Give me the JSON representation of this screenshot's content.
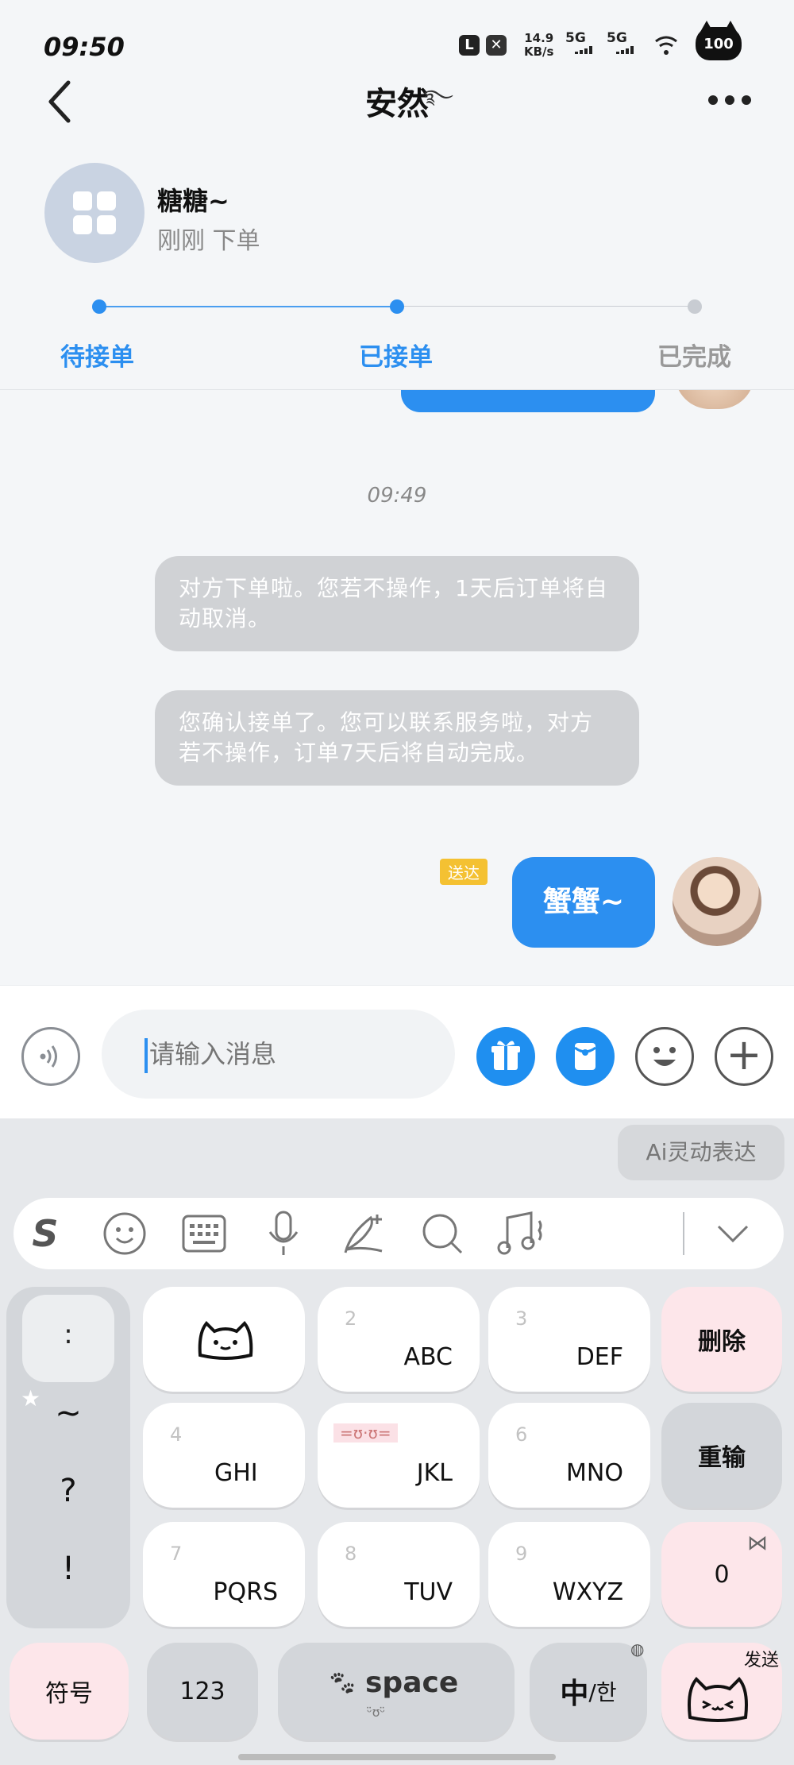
{
  "status_bar": {
    "time": "09:50",
    "net_speed": "14.9",
    "net_speed_unit": "KB/s",
    "signal1": "5G",
    "signal2": "5G",
    "battery": "100"
  },
  "header": {
    "title": "安然",
    "title_deco": "࿐"
  },
  "order": {
    "buyer_name": "糖糖~",
    "status_text": "刚刚 下单",
    "steps": [
      {
        "label": "待接单"
      },
      {
        "label": "已接单"
      },
      {
        "label": "已完成"
      }
    ],
    "current_step": 2
  },
  "chat": {
    "timestamp": "09:49",
    "system_messages": [
      "对方下单啦。您若不操作，1天后订单将自动取消。",
      "您确认接单了。您可以联系服务啦，对方若不操作，订单7天后将自动完成。"
    ],
    "my_message": "蟹蟹~",
    "read_tag": "送达"
  },
  "input_bar": {
    "placeholder": "请输入消息"
  },
  "keyboard": {
    "ai_express": "Ai灵动表达",
    "symbol_column": [
      ":",
      "~",
      "?",
      "!"
    ],
    "row1": [
      {
        "num": "",
        "label": ""
      },
      {
        "num": "2",
        "label": "ABC"
      },
      {
        "num": "3",
        "label": "DEF"
      }
    ],
    "row2": [
      {
        "num": "4",
        "label": "GHI"
      },
      {
        "num": "",
        "label": "JKL",
        "emote": "=ʊ·ʊ="
      },
      {
        "num": "6",
        "label": "MNO"
      }
    ],
    "row3": [
      {
        "num": "7",
        "label": "PQRS"
      },
      {
        "num": "8",
        "label": "TUV"
      },
      {
        "num": "9",
        "label": "WXYZ"
      }
    ],
    "delete": "删除",
    "retype": "重输",
    "zero": "0",
    "symbols": "符号",
    "numbers": "123",
    "space": "space",
    "space_sub": "ᵕ̈ʊᵕ̈",
    "lang_cn": "中",
    "lang_kr": "/한",
    "send": "发送"
  },
  "colors": {
    "accent": "#2c8ff0",
    "pending_grey": "#c8ccd2",
    "read_tag": "#f4c132",
    "pink_key": "#fde6ea"
  }
}
